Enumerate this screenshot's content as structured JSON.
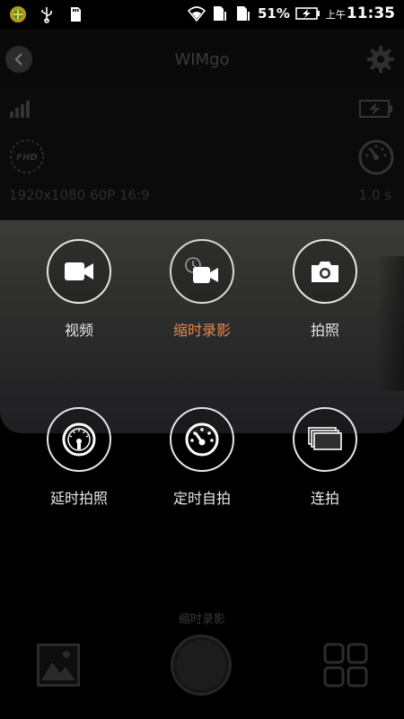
{
  "status_bar": {
    "battery_percent": "51%",
    "time_prefix": "上午",
    "time": "11:35"
  },
  "header": {
    "title": "WIMgo"
  },
  "info": {
    "quality_badge": "FHD",
    "resolution": "1920x1080 60P 16:9",
    "interval": "1.0 s"
  },
  "modes": [
    {
      "label": "视频",
      "icon": "video-camera-icon",
      "active": false
    },
    {
      "label": "缩时录影",
      "icon": "timelapse-video-icon",
      "active": true
    },
    {
      "label": "拍照",
      "icon": "photo-camera-icon",
      "active": false
    },
    {
      "label": "延时拍照",
      "icon": "timelapse-photo-dial-icon",
      "active": false
    },
    {
      "label": "定时自拍",
      "icon": "self-timer-dial-icon",
      "active": false
    },
    {
      "label": "连拍",
      "icon": "burst-stack-icon",
      "active": false
    }
  ],
  "bottom": {
    "current_mode": "缩时录影"
  },
  "colors": {
    "accent": "#e6894f",
    "panel": "#353534"
  }
}
